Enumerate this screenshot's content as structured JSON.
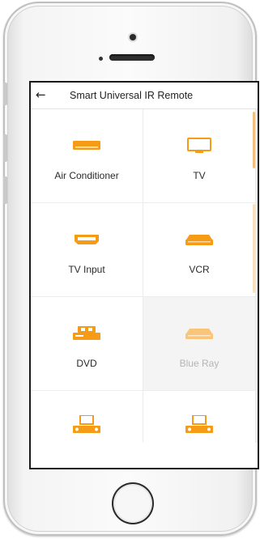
{
  "app": {
    "title": "Smart Universal IR Remote",
    "back_icon": "←",
    "accent_color": "#f59b16"
  },
  "devices": [
    {
      "label": "Air Conditioner",
      "icon": "air-conditioner-icon",
      "enabled": true
    },
    {
      "label": "TV",
      "icon": "tv-icon",
      "enabled": true
    },
    {
      "label": "TV Input",
      "icon": "tv-input-icon",
      "enabled": true
    },
    {
      "label": "VCR",
      "icon": "vcr-icon",
      "enabled": true
    },
    {
      "label": "DVD",
      "icon": "dvd-icon",
      "enabled": true
    },
    {
      "label": "Blue Ray",
      "icon": "blue-ray-icon",
      "enabled": false
    },
    {
      "label": "",
      "icon": "home-theater-icon",
      "enabled": true
    },
    {
      "label": "",
      "icon": "home-theater-icon",
      "enabled": true
    }
  ]
}
